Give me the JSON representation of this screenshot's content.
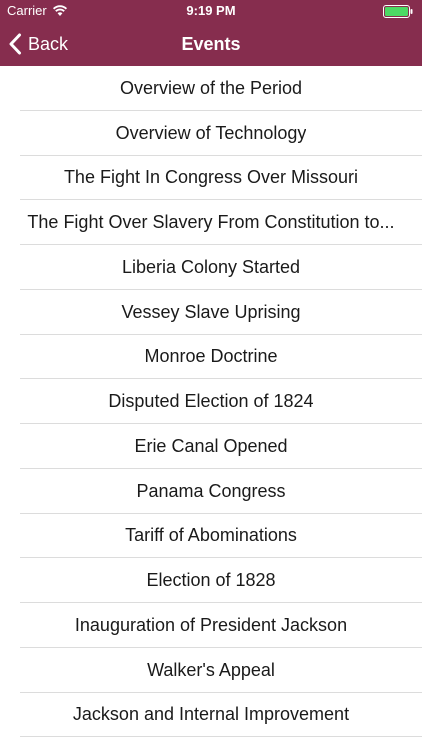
{
  "status_bar": {
    "carrier": "Carrier",
    "time": "9:19 PM",
    "battery_color": "#4cd964"
  },
  "nav": {
    "back_label": "Back",
    "title": "Events",
    "brand_color": "#862d4e"
  },
  "events": [
    "Overview of the Period",
    "Overview of Technology",
    "The Fight In Congress Over Missouri",
    "The Fight Over Slavery From Constitution to...",
    "Liberia Colony Started",
    "Vessey Slave Uprising",
    "Monroe Doctrine",
    "Disputed Election of 1824",
    "Erie Canal Opened",
    "Panama Congress",
    "Tariff of Abominations",
    "Election of 1828",
    "Inauguration of President Jackson",
    "Walker's Appeal",
    "Jackson and Internal Improvement"
  ]
}
